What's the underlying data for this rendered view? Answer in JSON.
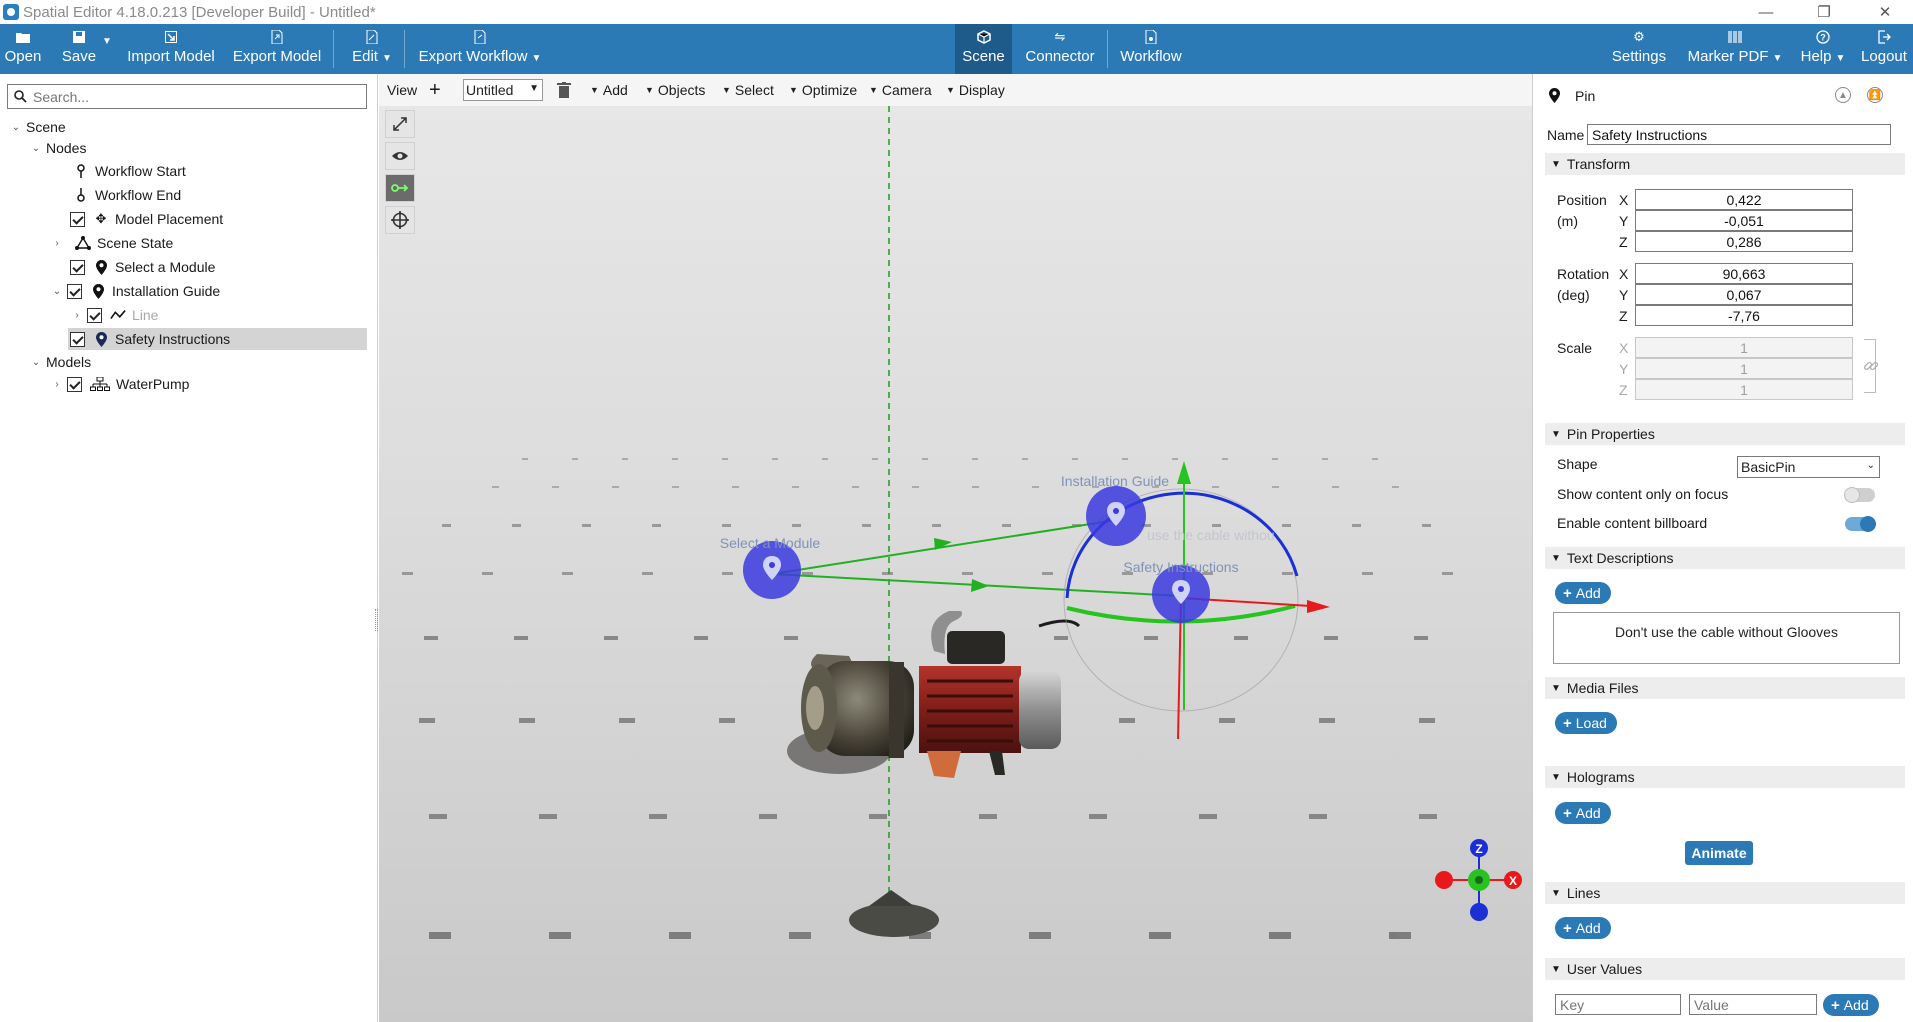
{
  "window": {
    "title": "Spatial Editor 4.18.0.213 [Developer Build] - Untitled*",
    "minimize": "—",
    "restore": "❐",
    "close": "✕"
  },
  "toolbar": {
    "open": "Open",
    "save": "Save",
    "import_model": "Import Model",
    "export_model": "Export Model",
    "edit": "Edit",
    "export_workflow": "Export Workflow",
    "scene": "Scene",
    "connector": "Connector",
    "workflow": "Workflow",
    "settings": "Settings",
    "marker_pdf": "Marker PDF",
    "help": "Help",
    "logout": "Logout"
  },
  "left_panel": {
    "search_placeholder": "Search...",
    "tree": {
      "scene": "Scene",
      "nodes": "Nodes",
      "workflow_start": "Workflow Start",
      "workflow_end": "Workflow End",
      "model_placement": "Model Placement",
      "scene_state": "Scene State",
      "select_a_module": "Select a Module",
      "installation_guide": "Installation Guide",
      "line": "Line",
      "safety_instructions": "Safety Instructions",
      "models": "Models",
      "water_pump": "WaterPump"
    }
  },
  "viewport": {
    "toolbar": {
      "view": "View",
      "view_name": "Untitled",
      "add": "Add",
      "objects": "Objects",
      "select": "Select",
      "optimize": "Optimize",
      "camera": "Camera",
      "display": "Display"
    },
    "labels": {
      "select_a_module": "Select a Module",
      "installation_guide": "Installation Guide",
      "safety_instructions": "Safety Instructions",
      "overlay_text": "use the cable withou"
    },
    "axes": {
      "x": "X",
      "z": "Z"
    },
    "colors": {
      "pin": "#3a3adf",
      "axis_x": "#e8191c",
      "axis_y": "#27c31f",
      "axis_z": "#1a2fd6",
      "path": "#22b022"
    }
  },
  "right_panel": {
    "header_title": "Pin",
    "name_label": "Name",
    "name_value": "Safety Instructions",
    "transform": {
      "title": "Transform",
      "position_label_1": "Position",
      "position_label_2": "(m)",
      "position": {
        "x": "0,422",
        "y": "-0,051",
        "z": "0,286"
      },
      "rotation_label_1": "Rotation",
      "rotation_label_2": "(deg)",
      "rotation": {
        "x": "90,663",
        "y": "0,067",
        "z": "-7,76"
      },
      "scale_label": "Scale",
      "scale": {
        "x": "1",
        "y": "1",
        "z": "1"
      },
      "axis_x": "X",
      "axis_y": "Y",
      "axis_z": "Z"
    },
    "pin_properties": {
      "title": "Pin Properties",
      "shape_label": "Shape",
      "shape_value": "BasicPin",
      "show_content_only_on_focus": "Show content only on focus",
      "show_content_only_on_focus_on": false,
      "enable_content_billboard": "Enable content billboard",
      "enable_content_billboard_on": true
    },
    "text_descriptions": {
      "title": "Text Descriptions",
      "add": "Add",
      "entry": "Don't use the cable without Glooves"
    },
    "media_files": {
      "title": "Media Files",
      "load": "Load"
    },
    "holograms": {
      "title": "Holograms",
      "add": "Add",
      "animate": "Animate"
    },
    "lines": {
      "title": "Lines",
      "add": "Add"
    },
    "user_values": {
      "title": "User Values",
      "key_placeholder": "Key",
      "value_placeholder": "Value",
      "add": "Add"
    }
  }
}
